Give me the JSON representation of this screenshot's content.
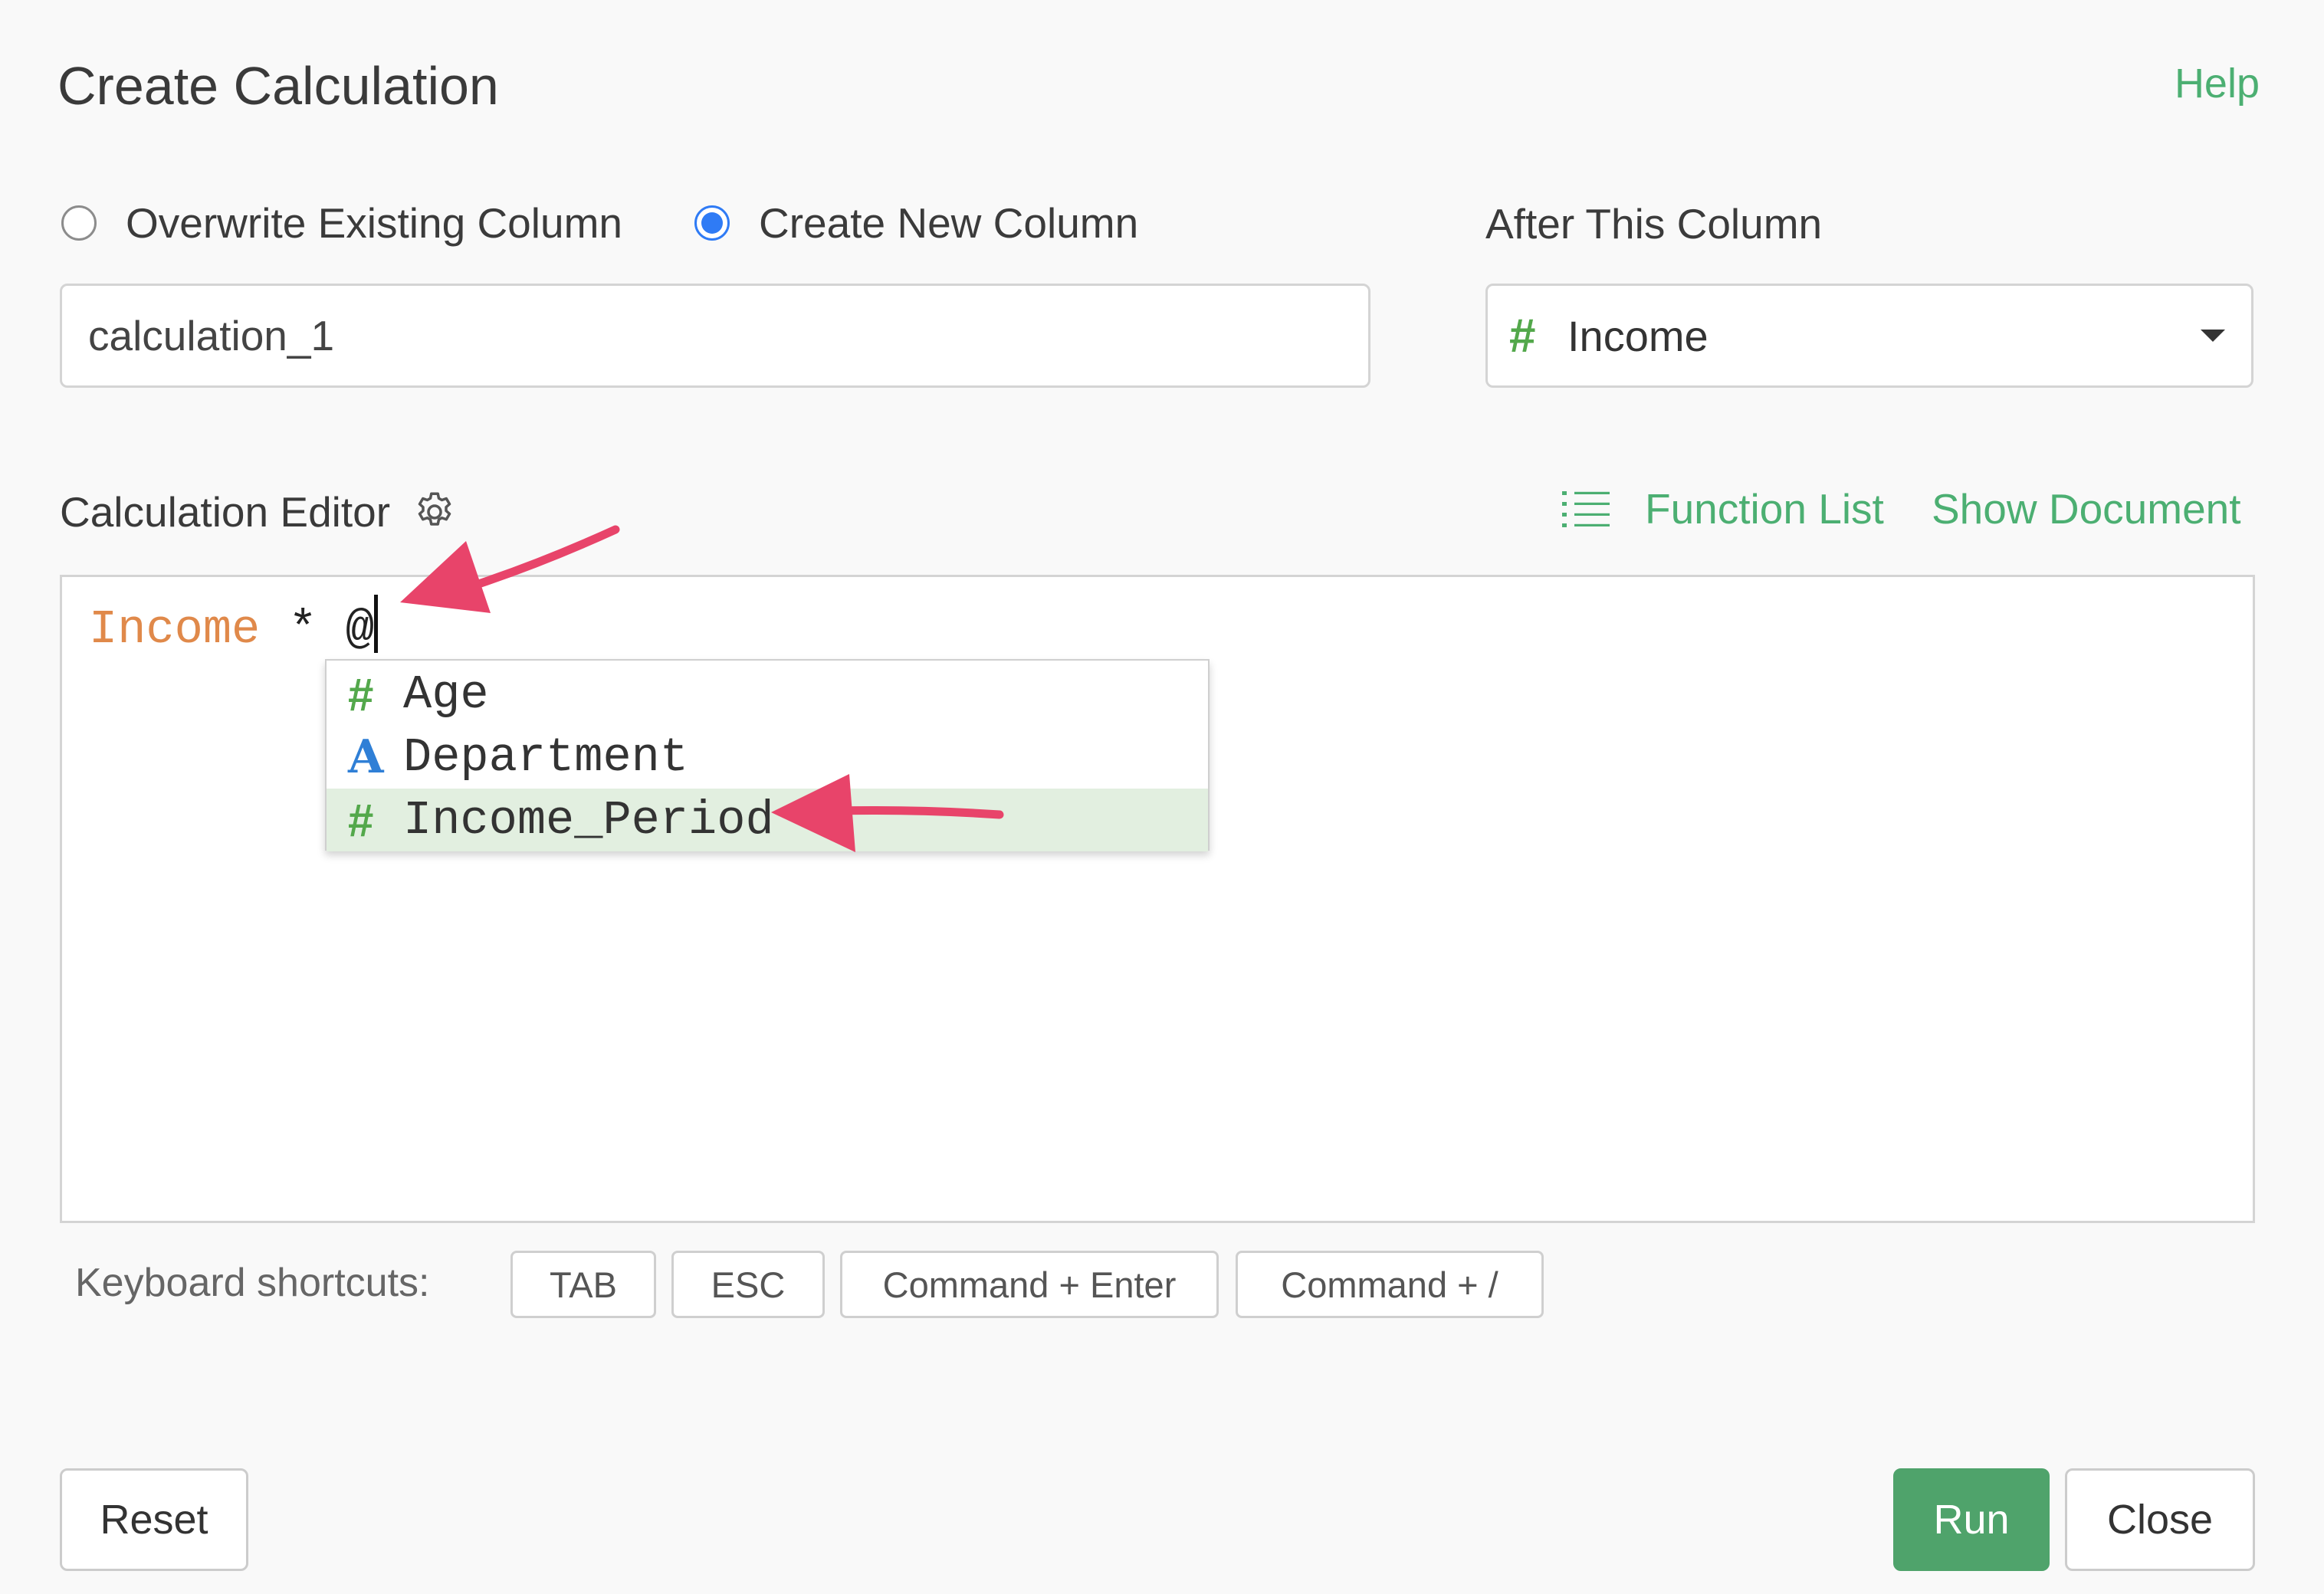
{
  "dialog": {
    "title": "Create Calculation",
    "help_label": "Help"
  },
  "mode": {
    "options": [
      {
        "label": "Overwrite Existing Column",
        "selected": false
      },
      {
        "label": "Create New Column",
        "selected": true
      }
    ]
  },
  "new_column": {
    "name_value": "calculation_1"
  },
  "position": {
    "label": "After This Column",
    "selected_type_icon": "#",
    "selected_value": "Income"
  },
  "editor": {
    "label": "Calculation Editor",
    "function_list_label": "Function List",
    "show_document_label": "Show Document",
    "code": {
      "column": "Income",
      "operator": " * ",
      "trigger": "@"
    },
    "autocomplete": [
      {
        "type_icon": "#",
        "type": "number",
        "label": "Age",
        "highlighted": false
      },
      {
        "type_icon": "A",
        "type": "character",
        "label": "Department",
        "highlighted": false
      },
      {
        "type_icon": "#",
        "type": "number",
        "label": "Income_Period",
        "highlighted": true
      }
    ]
  },
  "shortcuts": {
    "label": "Keyboard shortcuts:",
    "keys": [
      "TAB",
      "ESC",
      "Command + Enter",
      "Command + /"
    ]
  },
  "footer": {
    "reset_label": "Reset",
    "run_label": "Run",
    "close_label": "Close"
  },
  "colors": {
    "accent_green": "#4caf72",
    "run_button": "#4fa36b",
    "radio_selected": "#2f7bf5",
    "annotation_arrow": "#e8446a",
    "column_token": "#e0894a"
  },
  "annotations": {
    "arrows": [
      "arrow-to-cursor",
      "arrow-to-income-period"
    ]
  }
}
